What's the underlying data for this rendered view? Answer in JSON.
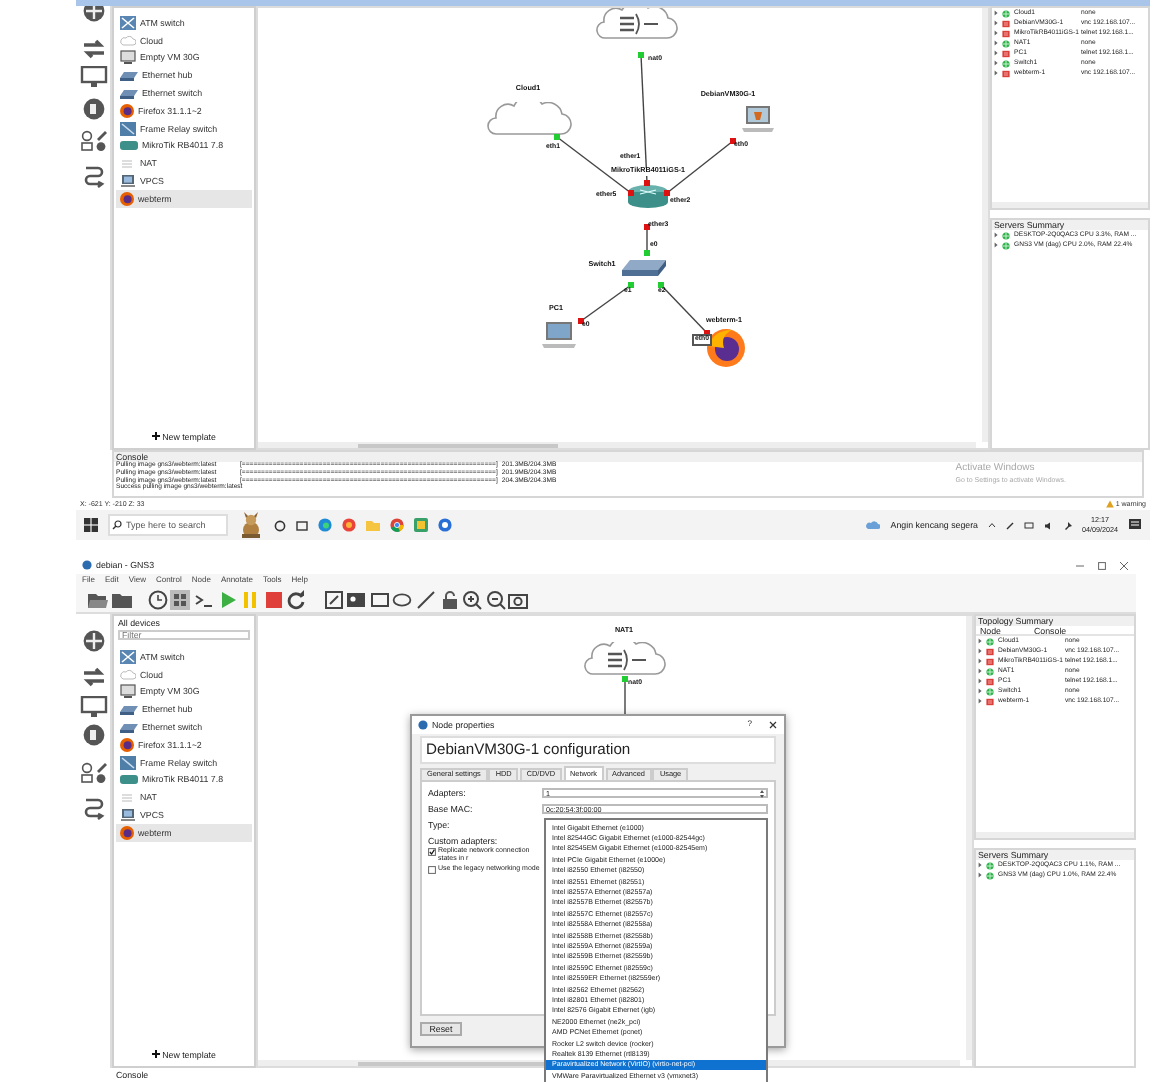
{
  "first_screenshot": {
    "devices": [
      {
        "label": "ATM switch",
        "kind": "atm",
        "selected": false
      },
      {
        "label": "Cloud",
        "kind": "cloud",
        "selected": false
      },
      {
        "label": "Empty VM 30G",
        "kind": "vm",
        "selected": false
      },
      {
        "label": "Ethernet hub",
        "kind": "hub",
        "selected": false
      },
      {
        "label": "Ethernet switch",
        "kind": "switch",
        "selected": false
      },
      {
        "label": "Firefox 31.1.1~2",
        "kind": "firefox",
        "selected": false
      },
      {
        "label": "Frame Relay switch",
        "kind": "frame-relay",
        "selected": false
      },
      {
        "label": "MikroTik RB4011 7.8",
        "kind": "router",
        "selected": false
      },
      {
        "label": "NAT",
        "kind": "nat",
        "selected": false
      },
      {
        "label": "VPCS",
        "kind": "vpcs",
        "selected": false
      },
      {
        "label": "webterm",
        "kind": "firefox",
        "selected": true
      }
    ],
    "new_template": "New template",
    "canvas": {
      "nodes": [
        {
          "kind": "nat-cloud"
        },
        {
          "kind": "cloud",
          "label": "Cloud1"
        },
        {
          "kind": "vm-laptop",
          "label": "DebianVM30G-1"
        },
        {
          "kind": "router",
          "label": "MikroTikRB4011iGS-1"
        },
        {
          "kind": "switch",
          "label": "Switch1"
        },
        {
          "kind": "pc-laptop",
          "label": "PC1"
        },
        {
          "kind": "browser",
          "label": "webterm-1"
        }
      ],
      "ports": [
        {
          "text": "nat0",
          "color": "#22cc33"
        },
        {
          "text": "eth1",
          "color": "#22cc33"
        },
        {
          "text": "eth0",
          "color": "#dd1111"
        },
        {
          "text": "ether1",
          "color": "#dd1111"
        },
        {
          "text": "ether5",
          "color": "#dd1111"
        },
        {
          "text": "ether2",
          "color": "#dd1111"
        },
        {
          "text": "ether3",
          "color": "#dd1111"
        },
        {
          "text": "e0",
          "color": "#22cc33"
        },
        {
          "text": "e1",
          "color": "#22cc33"
        },
        {
          "text": "e2",
          "color": "#22cc33"
        },
        {
          "text": "e0",
          "color": "#dd1111"
        },
        {
          "text": "eth0",
          "color": "#dd1111"
        }
      ]
    },
    "topology_summary": {
      "rows": [
        {
          "node": "Cloud1",
          "console": "none",
          "running": true
        },
        {
          "node": "DebianVM30G-1",
          "console": "vnc 192.168.107...",
          "running": false
        },
        {
          "node": "MikroTikRB4011iGS-1",
          "console": "telnet 192.168.1...",
          "running": false
        },
        {
          "node": "NAT1",
          "console": "none",
          "running": true
        },
        {
          "node": "PC1",
          "console": "telnet 192.168.1...",
          "running": false
        },
        {
          "node": "Switch1",
          "console": "none",
          "running": true
        },
        {
          "node": "webterm-1",
          "console": "vnc 192.168.107...",
          "running": false
        }
      ]
    },
    "servers_summary": {
      "title": "Servers Summary",
      "rows": [
        {
          "text": "DESKTOP-2Q0QAC3 CPU 3.3%, RAM ...",
          "running": true
        },
        {
          "text": "GNS3 VM (dag) CPU 2.0%, RAM 22.4%",
          "running": true
        }
      ]
    },
    "console": {
      "title": "Console",
      "lines": [
        {
          "message": "Pulling image gns3/webterm:latest",
          "bar": "[==================================================================]",
          "size": "201.3MB/204.3MB"
        },
        {
          "message": "Pulling image gns3/webterm:latest",
          "bar": "[==================================================================]",
          "size": "201.9MB/204.3MB"
        },
        {
          "message": "Pulling image gns3/webterm:latest",
          "bar": "[==================================================================]",
          "size": "204.3MB/204.3MB"
        },
        {
          "message": "Success pulling image gns3/webterm:latest"
        }
      ]
    },
    "activation": {
      "title": "Activate Windows",
      "hint": "Go to Settings to activate Windows."
    },
    "coordinates": "X: -621 Y: -210 Z: 33",
    "errors": "1 warning",
    "taskbar": {
      "search_placeholder": "Type here to search",
      "weather": "Angin kencang segera",
      "time": "12:17",
      "date": "04/09/2024"
    }
  },
  "second_screenshot": {
    "window_title": "debian - GNS3",
    "menu": [
      "File",
      "Edit",
      "View",
      "Control",
      "Node",
      "Annotate",
      "Tools",
      "Help"
    ],
    "devices_title": "All devices",
    "filter_placeholder": "Filter",
    "devices": [
      {
        "label": "ATM switch",
        "kind": "atm",
        "selected": false
      },
      {
        "label": "Cloud",
        "kind": "cloud",
        "selected": false
      },
      {
        "label": "Empty VM 30G",
        "kind": "vm",
        "selected": false
      },
      {
        "label": "Ethernet hub",
        "kind": "hub",
        "selected": false
      },
      {
        "label": "Ethernet switch",
        "kind": "switch",
        "selected": false
      },
      {
        "label": "Firefox 31.1.1~2",
        "kind": "firefox",
        "selected": false
      },
      {
        "label": "Frame Relay switch",
        "kind": "frame-relay",
        "selected": false
      },
      {
        "label": "MikroTik RB4011 7.8",
        "kind": "router",
        "selected": false
      },
      {
        "label": "NAT",
        "kind": "nat",
        "selected": false
      },
      {
        "label": "VPCS",
        "kind": "vpcs",
        "selected": false
      },
      {
        "label": "webterm",
        "kind": "firefox",
        "selected": true
      }
    ],
    "new_template": "New template",
    "canvas": {
      "nodes": [
        {
          "kind": "nat-cloud",
          "label": "NAT1"
        }
      ],
      "ports": [
        {
          "text": "nat0",
          "color": "#22cc33"
        }
      ]
    },
    "topology_summary": {
      "title": "Topology Summary",
      "columns": [
        "Node",
        "Console"
      ],
      "rows": [
        {
          "node": "Cloud1",
          "console": "none",
          "running": true
        },
        {
          "node": "DebianVM30G-1",
          "console": "vnc 192.168.107...",
          "running": false
        },
        {
          "node": "MikroTikRB4011iGS-1",
          "console": "telnet 192.168.1...",
          "running": false
        },
        {
          "node": "NAT1",
          "console": "none",
          "running": true
        },
        {
          "node": "PC1",
          "console": "telnet 192.168.1...",
          "running": false
        },
        {
          "node": "Switch1",
          "console": "none",
          "running": true
        },
        {
          "node": "webterm-1",
          "console": "vnc 192.168.107...",
          "running": false
        }
      ]
    },
    "servers_summary": {
      "title": "Servers Summary",
      "rows": [
        {
          "text": "DESKTOP-2Q0QAC3 CPU 1.1%, RAM ...",
          "running": true
        },
        {
          "text": "GNS3 VM (dag) CPU 1.0%, RAM 22.4%",
          "running": true
        }
      ]
    },
    "console": {
      "title": "Console"
    },
    "dialog": {
      "title": "Node properties",
      "help": "?",
      "heading": "DebianVM30G-1 configuration",
      "tabs": [
        {
          "label": "General settings",
          "selected": false
        },
        {
          "label": "HDD",
          "selected": false
        },
        {
          "label": "CD/DVD",
          "selected": false
        },
        {
          "label": "Network",
          "selected": true
        },
        {
          "label": "Advanced",
          "selected": false
        },
        {
          "label": "Usage",
          "selected": false
        }
      ],
      "fields": [
        {
          "label": "Adapters:",
          "kind": "spinbox",
          "value": "1"
        },
        {
          "label": "Base MAC:",
          "kind": "text",
          "value": "0c:20:54:3f:00:00"
        },
        {
          "label": "Type:",
          "kind": "label"
        },
        {
          "label": "Custom adapters:",
          "kind": "label"
        }
      ],
      "checkboxes": [
        {
          "label": "Replicate network connection states in r",
          "checked": true
        },
        {
          "label": "Use the legacy networking mode",
          "checked": false
        }
      ],
      "type_options": [
        {
          "label": "Intel Gigabit Ethernet (e1000)",
          "selected": false
        },
        {
          "label": "Intel 82544GC Gigabit Ethernet (e1000-82544gc)",
          "selected": false
        },
        {
          "label": "Intel 82545EM Gigabit Ethernet (e1000-82545em)",
          "selected": false
        },
        {
          "label": "Intel PCIe Gigabit Ethernet (e1000e)",
          "selected": false
        },
        {
          "label": "Intel i82550 Ethernet (i82550)",
          "selected": false
        },
        {
          "label": "Intel i82551 Ethernet (i82551)",
          "selected": false
        },
        {
          "label": "Intel i82557A Ethernet (i82557a)",
          "selected": false
        },
        {
          "label": "Intel i82557B Ethernet (i82557b)",
          "selected": false
        },
        {
          "label": "Intel i82557C Ethernet (i82557c)",
          "selected": false
        },
        {
          "label": "Intel i82558A Ethernet (i82558a)",
          "selected": false
        },
        {
          "label": "Intel i82558B Ethernet (i82558b)",
          "selected": false
        },
        {
          "label": "Intel i82559A Ethernet (i82559a)",
          "selected": false
        },
        {
          "label": "Intel i82559B Ethernet (i82559b)",
          "selected": false
        },
        {
          "label": "Intel i82559C Ethernet (i82559c)",
          "selected": false
        },
        {
          "label": "Intel i82559ER Ethernet (i82559er)",
          "selected": false
        },
        {
          "label": "Intel i82562 Ethernet (i82562)",
          "selected": false
        },
        {
          "label": "Intel i82801 Ethernet (i82801)",
          "selected": false
        },
        {
          "label": "Intel 82576 Gigabit Ethernet (igb)",
          "selected": false
        },
        {
          "label": "NE2000 Ethernet (ne2k_pci)",
          "selected": false
        },
        {
          "label": "AMD PCNet Ethernet (pcnet)",
          "selected": false
        },
        {
          "label": "Rocker L2 switch device (rocker)",
          "selected": false
        },
        {
          "label": "Realtek 8139 Ethernet (rtl8139)",
          "selected": false
        },
        {
          "label": "Paravirtualized Network (VirtIO) (virtio-net-pci)",
          "selected": true
        },
        {
          "label": "VMWare Paravirtualized Ethernet v3 (vmxnet3)",
          "selected": false
        }
      ],
      "reset": "Reset"
    }
  }
}
